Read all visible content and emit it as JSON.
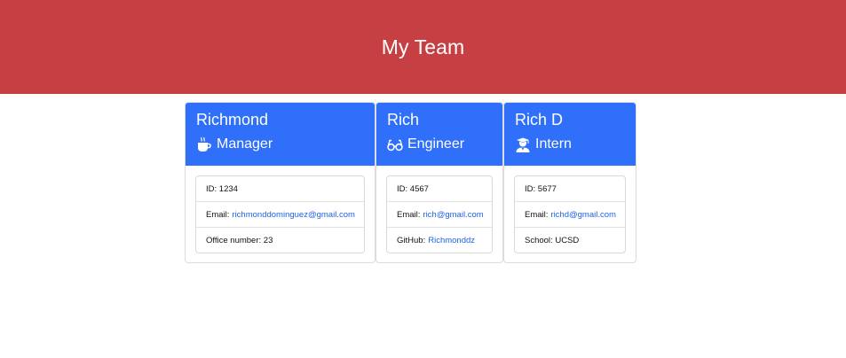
{
  "header": {
    "title": "My Team"
  },
  "colors": {
    "header_bg": "#c63f42",
    "card_header_bg": "#2f6ff9",
    "link": "#1c63e8"
  },
  "cards": [
    {
      "name": "Richmond",
      "role": "Manager",
      "icon": "coffee-cup-icon",
      "id_label": "ID:",
      "id": "1234",
      "email_label": "Email:",
      "email": "richmonddominguez@gmail.com",
      "extra_label": "Office number:",
      "extra": "23"
    },
    {
      "name": "Rich",
      "role": "Engineer",
      "icon": "glasses-icon",
      "id_label": "ID:",
      "id": "4567",
      "email_label": "Email:",
      "email": "rich@gmail.com",
      "extra_label": "GitHub:",
      "extra": "Richmonddz"
    },
    {
      "name": "Rich D",
      "role": "Intern",
      "icon": "graduate-icon",
      "id_label": "ID:",
      "id": "5677",
      "email_label": "Email:",
      "email": "richd@gmail.com",
      "extra_label": "School:",
      "extra": "UCSD"
    }
  ]
}
